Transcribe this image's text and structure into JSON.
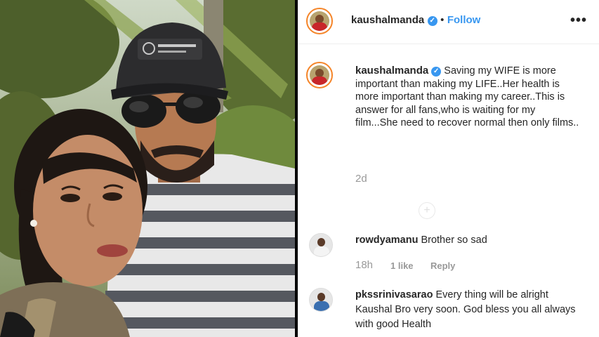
{
  "post": {
    "author": "kaushalmanda",
    "follow_label": "Follow",
    "separator": "•",
    "more_label": "•••",
    "caption": "Saving my WIFE is more important than making my LIFE..Her health is more important than making my career..This is answer for all fans,who is waiting for my film...She need to recover normal then only films..",
    "time": "2d",
    "load_more": "+"
  },
  "comments": [
    {
      "user": "rowdyamanu",
      "text": "Brother so sad",
      "time": "18h",
      "likes": "1 like",
      "reply": "Reply"
    },
    {
      "user": "pkssrinivasarao",
      "text": "Every thing will be alright Kaushal Bro very soon. God bless you all always with good Health"
    }
  ],
  "icons": {
    "verified": "verified-badge-icon",
    "more": "more-options-icon"
  },
  "colors": {
    "accent": "#3897f0",
    "muted": "#999999",
    "text": "#262626"
  }
}
